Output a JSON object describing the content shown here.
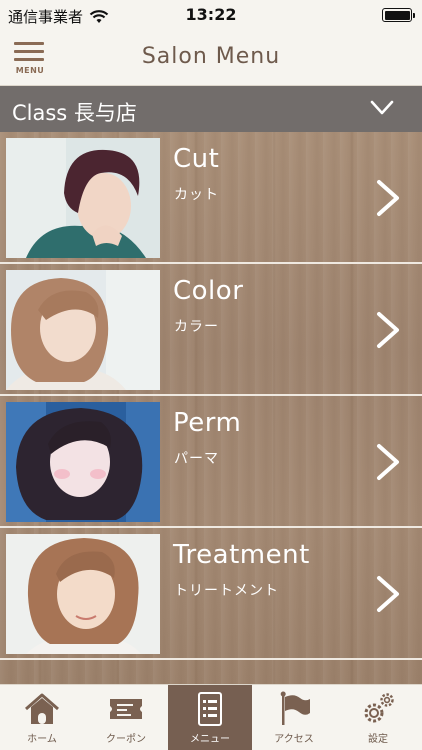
{
  "status_bar": {
    "carrier": "通信事業者",
    "time": "13:22"
  },
  "header": {
    "menu_label": "MENU",
    "title": "Salon Menu"
  },
  "store": {
    "name": "Class 長与店"
  },
  "menu_items": [
    {
      "title": "Cut",
      "subtitle": "カット"
    },
    {
      "title": "Color",
      "subtitle": "カラー"
    },
    {
      "title": "Perm",
      "subtitle": "パーマ"
    },
    {
      "title": "Treatment",
      "subtitle": "トリートメント"
    }
  ],
  "tabs": [
    {
      "label": "ホーム",
      "icon": "home-icon"
    },
    {
      "label": "クーポン",
      "icon": "coupon-icon"
    },
    {
      "label": "メニュー",
      "icon": "menu-list-icon",
      "active": true
    },
    {
      "label": "アクセス",
      "icon": "flag-icon"
    },
    {
      "label": "設定",
      "icon": "gear-icon"
    }
  ],
  "colors": {
    "accent_brown": "#765f51",
    "store_bar": "#726d6b",
    "wood": "#a48a74",
    "text_brown": "#6e5a4c"
  }
}
